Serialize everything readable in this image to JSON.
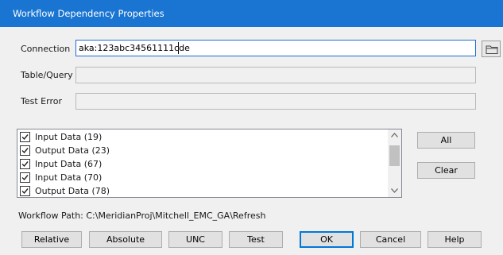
{
  "window": {
    "title": "Workflow Dependency Properties"
  },
  "form": {
    "connection_label": "Connection",
    "connection_value": "aka:123abc34561111cde",
    "table_query_label": "Table/Query",
    "test_error_label": "Test Error"
  },
  "list": {
    "items": [
      {
        "label": "Input Data (19)",
        "checked": true
      },
      {
        "label": "Output Data (23)",
        "checked": true
      },
      {
        "label": "Input Data (67)",
        "checked": true
      },
      {
        "label": "Input Data (70)",
        "checked": true
      },
      {
        "label": "Output Data (78)",
        "checked": true
      }
    ]
  },
  "side_buttons": {
    "all": "All",
    "clear": "Clear"
  },
  "workflow_path": {
    "text": "Workflow Path: C:\\MeridianProj\\Mitchell_EMC_GA\\Refresh"
  },
  "buttons": {
    "relative": "Relative",
    "absolute": "Absolute",
    "unc": "UNC",
    "test": "Test",
    "ok": "OK",
    "cancel": "Cancel",
    "help": "Help"
  },
  "icons": {
    "browse": "folder-icon",
    "check": "checkmark-icon",
    "scroll_up": "chevron-up-icon",
    "scroll_down": "chevron-down-icon"
  },
  "colors": {
    "titlebar": "#1a75d2",
    "focus_border": "#0078d7"
  }
}
